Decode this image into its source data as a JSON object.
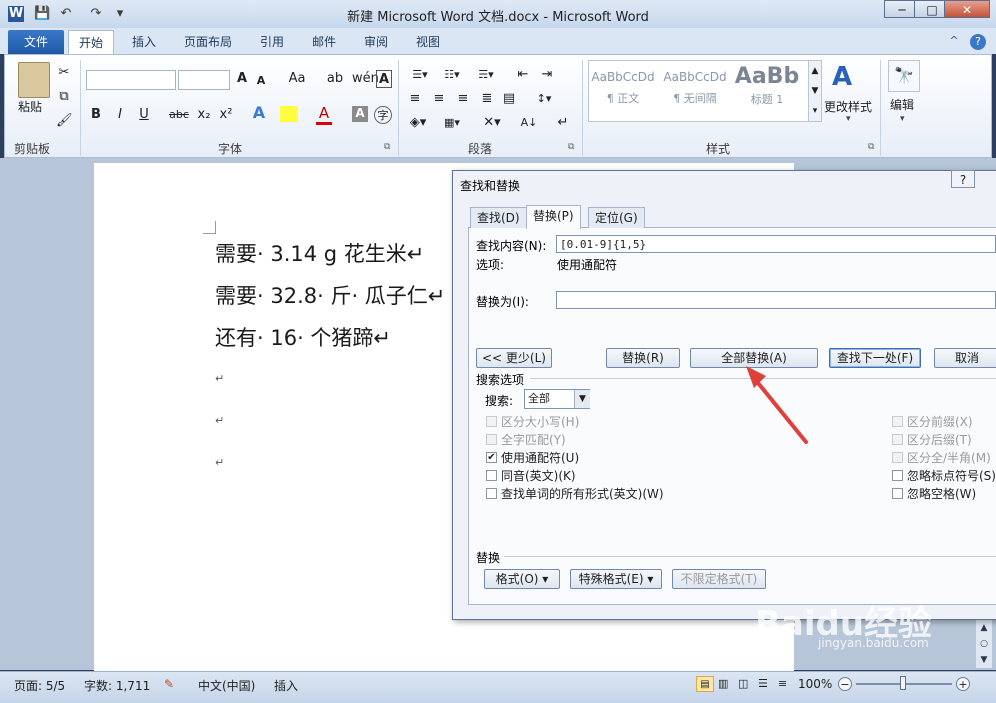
{
  "window": {
    "title": "新建 Microsoft Word 文档.docx - Microsoft Word",
    "controls": [
      "─",
      "□",
      "✕"
    ]
  },
  "qat": {
    "app_letter": "W",
    "save": "💾",
    "undo": "↶",
    "redo": "↷",
    "more": "▾"
  },
  "tabs": {
    "file": "文件",
    "items": [
      "开始",
      "插入",
      "页面布局",
      "引用",
      "邮件",
      "审阅",
      "视图"
    ]
  },
  "ribbon": {
    "clipboard": {
      "paste": "粘贴",
      "label": "剪贴板"
    },
    "font": {
      "label": "字体",
      "bold": "B",
      "italic": "I",
      "underline": "U",
      "strike": "abc",
      "sub": "x₂",
      "sup": "x²",
      "grow": "A",
      "shrink": "A",
      "case": "Aa",
      "clear": "A"
    },
    "paragraph": {
      "label": "段落"
    },
    "styles": {
      "label": "样式",
      "items": [
        {
          "preview": "AaBbCcDd",
          "name": "¶ 正文"
        },
        {
          "preview": "AaBbCcDd",
          "name": "¶ 无间隔"
        },
        {
          "preview": "AaBb",
          "name": "标题 1"
        }
      ],
      "change_styles": "更改样式"
    },
    "editing": {
      "label": "编辑"
    },
    "icons": {
      "help": "?",
      "minimize_ribbon": "^"
    }
  },
  "document": {
    "lines": [
      "需要· 3.14 g 花生米↵",
      "需要· 32.8· 斤· 瓜子仁↵",
      "还有· 16· 个猪蹄↵"
    ],
    "empty_para_mark": "↵"
  },
  "dialog": {
    "title": "查找和替换",
    "help": "?",
    "tabs": [
      "查找(D)",
      "替换(P)",
      "定位(G)"
    ],
    "active_tab": 1,
    "find_label": "查找内容(N):",
    "find_value": "[0.01-9]{1,5}",
    "options_label": "选项:",
    "options_value": "使用通配符",
    "replace_label": "替换为(I):",
    "replace_value": "",
    "buttons": {
      "less": "<< 更少(L)",
      "replace": "替换(R)",
      "replace_all": "全部替换(A)",
      "find_next": "查找下一处(F)",
      "cancel": "取消"
    },
    "search_options": {
      "title": "搜索选项",
      "search_label": "搜索:",
      "search_value": "全部",
      "left": [
        {
          "label": "区分大小写(H)",
          "checked": false,
          "disabled": true
        },
        {
          "label": "全字匹配(Y)",
          "checked": false,
          "disabled": true
        },
        {
          "label": "使用通配符(U)",
          "checked": true,
          "disabled": false
        },
        {
          "label": "同音(英文)(K)",
          "checked": false,
          "disabled": false
        },
        {
          "label": "查找单词的所有形式(英文)(W)",
          "checked": false,
          "disabled": false
        }
      ],
      "right": [
        {
          "label": "区分前缀(X)",
          "checked": false,
          "disabled": true
        },
        {
          "label": "区分后缀(T)",
          "checked": false,
          "disabled": true
        },
        {
          "label": "区分全/半角(M)",
          "checked": false,
          "disabled": true
        },
        {
          "label": "忽略标点符号(S)",
          "checked": false,
          "disabled": false
        },
        {
          "label": "忽略空格(W)",
          "checked": false,
          "disabled": false
        }
      ]
    },
    "replace_section": {
      "title": "替换",
      "format": "格式(O) ▾",
      "special": "特殊格式(E) ▾",
      "no_format": "不限定格式(T)"
    }
  },
  "statusbar": {
    "page": "页面: 5/5",
    "words": "字数: 1,711",
    "language": "中文(中国)",
    "mode": "插入",
    "zoom": "100%"
  },
  "watermark": {
    "brand": "Baidu经验",
    "sub": "jingyan.baidu.com"
  },
  "colors": {
    "accent": "#1e5aa6",
    "arrow": "#e0403a"
  }
}
